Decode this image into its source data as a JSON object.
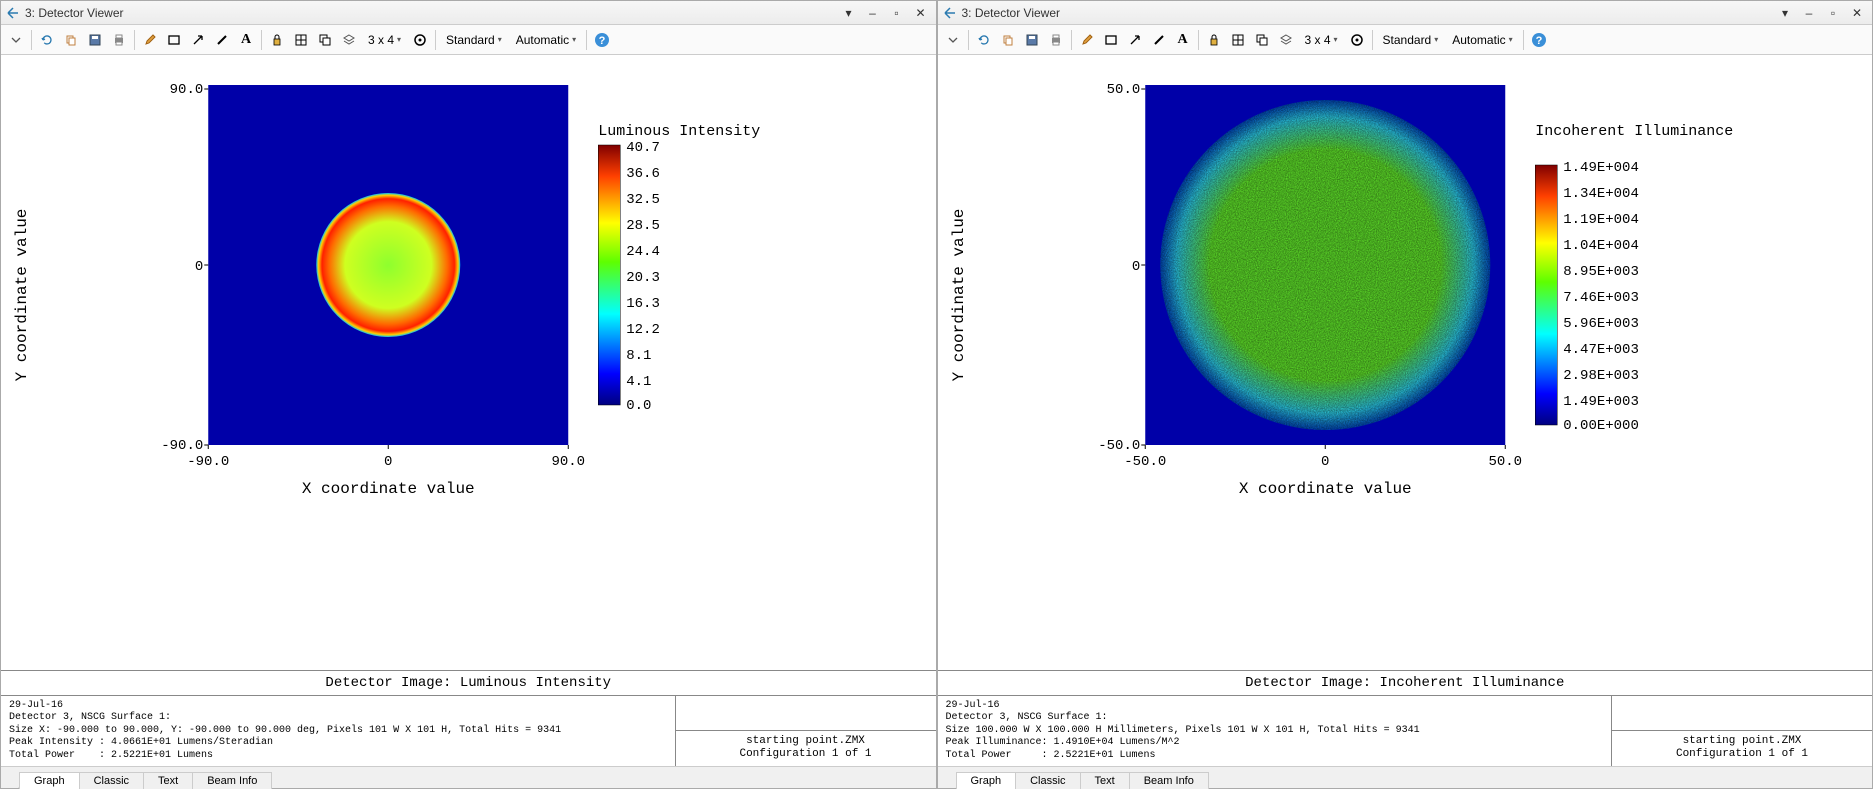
{
  "panels": [
    {
      "title": "3: Detector Viewer",
      "toolbar": {
        "grid": "3 x 4",
        "select1": "Standard",
        "select2": "Automatic"
      },
      "chart": {
        "ylabel": "Y coordinate value",
        "xlabel": "X coordinate value",
        "yticks": [
          "90.0",
          "0",
          "-90.0"
        ],
        "xticks": [
          "-90.0",
          "0",
          "90.0"
        ],
        "legend_title": "Luminous Intensity",
        "legend_ticks": [
          "40.7",
          "36.6",
          "32.5",
          "28.5",
          "24.4",
          "20.3",
          "16.3",
          "12.2",
          "8.1",
          "4.1",
          "0.0"
        ]
      },
      "info_title": "Detector Image: Luminous Intensity",
      "info_text": "29-Jul-16\nDetector 3, NSCG Surface 1:\nSize X: -90.000 to 90.000, Y: -90.000 to 90.000 deg, Pixels 101 W X 101 H, Total Hits = 9341\nPeak Intensity : 4.0661E+01 Lumens/Steradian\nTotal Power    : 2.5221E+01 Lumens",
      "config_text": "starting point.ZMX\nConfiguration 1 of 1",
      "tabs": [
        "Graph",
        "Classic",
        "Text",
        "Beam Info"
      ]
    },
    {
      "title": "3: Detector Viewer",
      "toolbar": {
        "grid": "3 x 4",
        "select1": "Standard",
        "select2": "Automatic"
      },
      "chart": {
        "ylabel": "Y coordinate value",
        "xlabel": "X coordinate value",
        "yticks": [
          "50.0",
          "0",
          "-50.0"
        ],
        "xticks": [
          "-50.0",
          "0",
          "50.0"
        ],
        "legend_title": "Incoherent Illuminance",
        "legend_ticks": [
          "1.49E+004",
          "1.34E+004",
          "1.19E+004",
          "1.04E+004",
          "8.95E+003",
          "7.46E+003",
          "5.96E+003",
          "4.47E+003",
          "2.98E+003",
          "1.49E+003",
          "0.00E+000"
        ]
      },
      "info_title": "Detector Image: Incoherent Illuminance",
      "info_text": "29-Jul-16\nDetector 3, NSCG Surface 1:\nSize 100.000 W X 100.000 H Millimeters, Pixels 101 W X 101 H, Total Hits = 9341\nPeak Illuminance: 1.4910E+04 Lumens/M^2\nTotal Power     : 2.5221E+01 Lumens",
      "config_text": "starting point.ZMX\nConfiguration 1 of 1",
      "tabs": [
        "Graph",
        "Classic",
        "Text",
        "Beam Info"
      ]
    }
  ],
  "chart_data": [
    {
      "type": "heatmap",
      "title": "Detector Image: Luminous Intensity",
      "xlabel": "X coordinate value",
      "ylabel": "Y coordinate value",
      "zlabel": "Luminous Intensity",
      "xlim": [
        -90.0,
        90.0
      ],
      "ylim": [
        -90.0,
        90.0
      ],
      "zlim": [
        0.0,
        40.7
      ],
      "colorbar_ticks": [
        0.0,
        4.1,
        8.1,
        12.2,
        16.3,
        20.3,
        24.4,
        28.5,
        32.5,
        36.6,
        40.7
      ],
      "description": "Circular spot centered near (0,0), angular radius ~30 deg. Interior mostly 20-30 Lumens/Steradian (green-yellow) with a bright ring near the perimeter reaching ~40.7 (red). Background outside the disk is ~0 (deep blue)."
    },
    {
      "type": "heatmap",
      "title": "Detector Image: Incoherent Illuminance",
      "xlabel": "X coordinate value",
      "ylabel": "Y coordinate value",
      "zlabel": "Incoherent Illuminance",
      "xlim": [
        -50.0,
        50.0
      ],
      "ylim": [
        -50.0,
        50.0
      ],
      "zlim": [
        0.0,
        14900
      ],
      "colorbar_ticks": [
        0,
        1490,
        2980,
        4470,
        5960,
        7460,
        8950,
        10400,
        11900,
        13400,
        14900
      ],
      "description": "Noisy speckled disk filling most of the 100x100 mm detector (radius ~45 mm). Values mostly 3000-9000 Lumens/M^2 (cyan-green-yellow) with scattered hot pixels near 1.49E4 (red). Background outside disk ~0."
    }
  ]
}
